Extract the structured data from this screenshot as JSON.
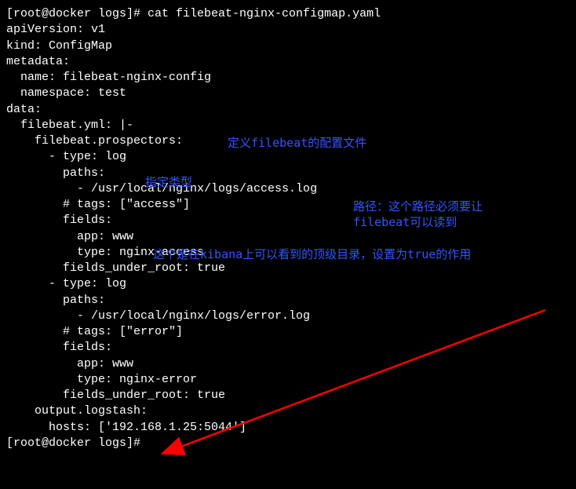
{
  "terminal": {
    "prompt1": "[root@docker logs]# cat filebeat-nginx-configmap.yaml",
    "l1": "apiVersion: v1",
    "l2": "kind: ConfigMap",
    "l3": "metadata:",
    "l4": "  name: filebeat-nginx-config",
    "l5": "  namespace: test",
    "blank1": "",
    "l6": "data:",
    "l7": "  filebeat.yml: |-",
    "l8": "    filebeat.prospectors:",
    "l9": "      - type: log",
    "l10": "        paths:",
    "l11": "          - /usr/local/nginx/logs/access.log",
    "l12": "        # tags: [\"access\"]",
    "l13": "        fields:",
    "l14": "          app: www",
    "l15": "          type: nginx-access",
    "l16": "        fields_under_root: true",
    "blank2": "",
    "l17": "      - type: log",
    "l18": "        paths:",
    "l19": "          - /usr/local/nginx/logs/error.log",
    "l20": "        # tags: [\"error\"]",
    "l21": "        fields:",
    "l22": "          app: www",
    "l23": "          type: nginx-error",
    "l24": "        fields_under_root: true",
    "blank3": "",
    "l25": "    output.logstash:",
    "l26": "      hosts: ['192.168.1.25:5044']",
    "prompt2": "[root@docker logs]#"
  },
  "annotations": {
    "a1": "定义filebeat的配置文件",
    "a2": "指定类型",
    "a3_l1": "路径：这个路径必须要让",
    "a3_l2": "filebeat可以读到",
    "a4": "这个是在kibana上可以看到的顶级目录，设置为true的作用"
  }
}
